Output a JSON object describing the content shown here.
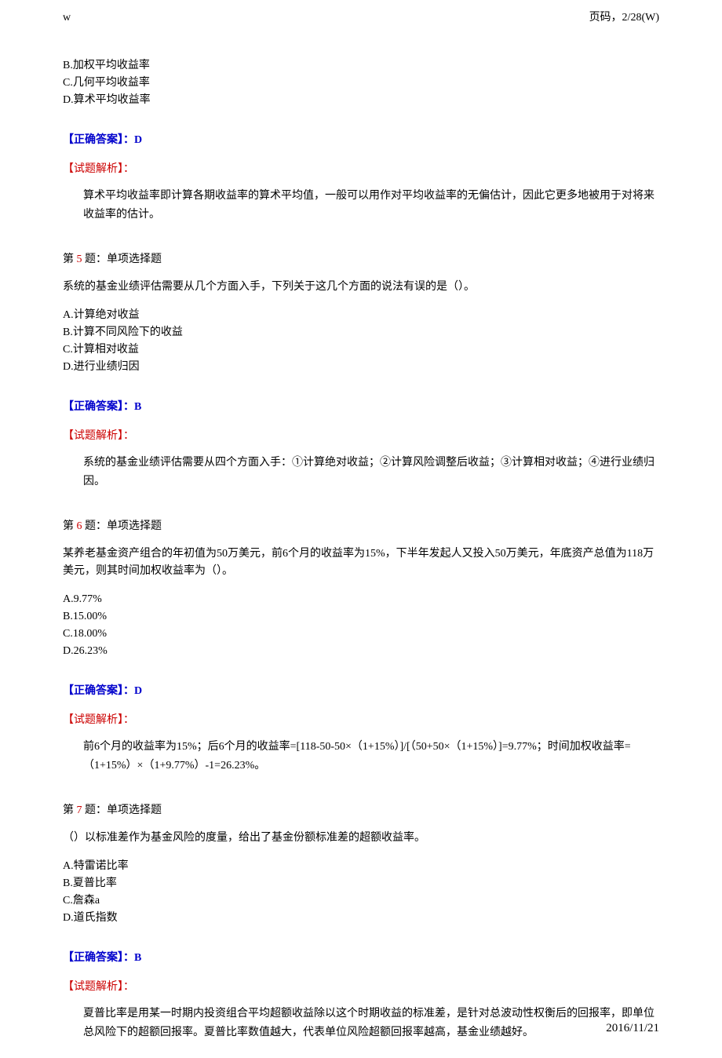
{
  "header": {
    "left": "w",
    "right": "页码，2/28(W)"
  },
  "q4_partial": {
    "options": {
      "b": "B.加权平均收益率",
      "c": "C.几何平均收益率",
      "d": "D.算术平均收益率"
    },
    "answer_label": "【正确答案】：D",
    "analysis_label": "【试题解析】：",
    "analysis_text": "算术平均收益率即计算各期收益率的算术平均值，一般可以用作对平均收益率的无偏估计，因此它更多地被用于对将来收益率的估计。"
  },
  "q5": {
    "header_prefix": "第 ",
    "header_num": "5",
    "header_suffix": " 题：单项选择题",
    "question": "系统的基金业绩评估需要从几个方面入手，下列关于这几个方面的说法有误的是（）。",
    "options": {
      "a": "A.计算绝对收益",
      "b": "B.计算不同风险下的收益",
      "c": "C.计算相对收益",
      "d": "D.进行业绩归因"
    },
    "answer_label": "【正确答案】：B",
    "analysis_label": "【试题解析】：",
    "analysis_text": "系统的基金业绩评估需要从四个方面入手：①计算绝对收益；②计算风险调整后收益；③计算相对收益；④进行业绩归因。"
  },
  "q6": {
    "header_prefix": "第 ",
    "header_num": "6",
    "header_suffix": " 题：单项选择题",
    "question": "某养老基金资产组合的年初值为50万美元，前6个月的收益率为15%，下半年发起人又投入50万美元，年底资产总值为118万美元，则其时间加权收益率为（）。",
    "options": {
      "a": "A.9.77%",
      "b": "B.15.00%",
      "c": "C.18.00%",
      "d": "D.26.23%"
    },
    "answer_label": "【正确答案】：D",
    "analysis_label": "【试题解析】：",
    "analysis_text": "前6个月的收益率为15%；后6个月的收益率=[118-50-50×（1+15%）]/[（50+50×（1+15%）]=9.77%；时间加权收益率=（1+15%）×（1+9.77%）-1=26.23%。"
  },
  "q7": {
    "header_prefix": "第 ",
    "header_num": "7",
    "header_suffix": " 题：单项选择题",
    "question": "（）以标准差作为基金风险的度量，给出了基金份额标准差的超额收益率。",
    "options": {
      "a": "A.特雷诺比率",
      "b": "B.夏普比率",
      "c": "C.詹森a",
      "d": "D.道氏指数"
    },
    "answer_label": "【正确答案】：B",
    "analysis_label": "【试题解析】：",
    "analysis_text": "夏普比率是用某一时期内投资组合平均超额收益除以这个时期收益的标准差，是针对总波动性权衡后的回报率，即单位总风险下的超额回报率。夏普比率数值越大，代表单位风险超额回报率越高，基金业绩越好。"
  },
  "footer": {
    "date": "2016/11/21"
  }
}
